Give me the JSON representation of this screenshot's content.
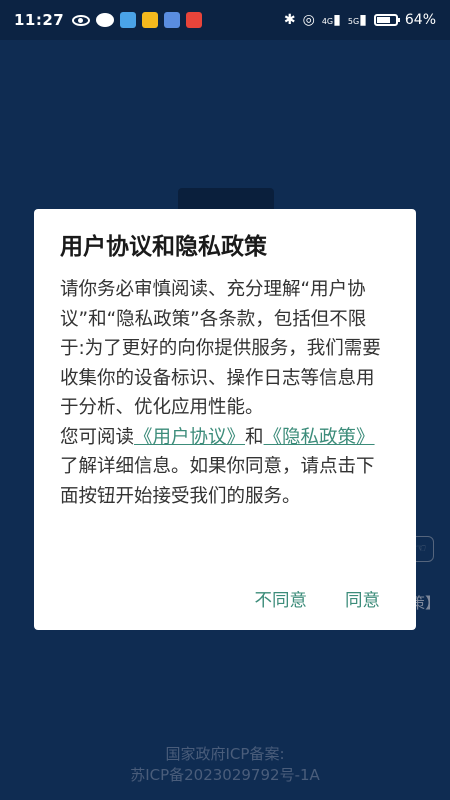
{
  "status_bar": {
    "time": "11:27",
    "network_4g": "4G",
    "network_5g": "5G",
    "battery": "64%"
  },
  "dialog": {
    "title": "用户协议和隐私政策",
    "body_part1": "请你务必审慎阅读、充分理解“用户协议”和“隐私政策”各条款，包括但不限于:为了更好的向你提供服务，我们需要收集你的设备标识、操作日志等信息用于分析、优化应用性能。",
    "body_part2_prefix": "您可阅读",
    "link_user_agreement": "《用户协议》",
    "body_part2_and": "和",
    "link_privacy_policy": "《隐私政策》",
    "body_part2_suffix": "了解详细信息。如果你同意，请点击下面按钮开始接受我们的服务。",
    "disagree_label": "不同意",
    "agree_label": "同意"
  },
  "background": {
    "right_text": "策】",
    "right_icon_glyph": "☜",
    "footer_line1": "国家政府ICP备案:",
    "footer_line2": "苏ICP备2023029792号-1A"
  },
  "colors": {
    "background": "#0f2c52",
    "accent": "#3c8c7a"
  }
}
